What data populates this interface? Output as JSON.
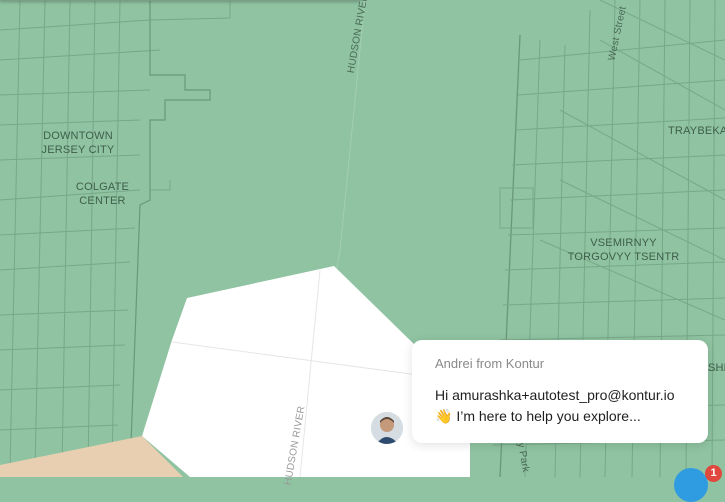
{
  "map": {
    "labels": {
      "downtown_line1": "DOWNTOWN",
      "downtown_line2": "JERSEY CITY",
      "colgate": "COLGATE CENTER",
      "tribeca": "TRAYBEKA",
      "wtc_line1": "VSEMIRNYY",
      "wtc_line2": "TORGOVYY TSENTR",
      "shl": "SHL"
    },
    "streets": {
      "hudson_river_top": "HUDSON RIVER",
      "hudson_river_bottom": "HUDSON RIVER",
      "west_street": "West Street",
      "parkway": "y Park"
    }
  },
  "chat": {
    "from": "Andrei from Kontur",
    "message_line1": "Hi amurashka+autotest_pro@kontur.io",
    "message_line2": "👋 I’m here to help you explore..."
  },
  "launcher": {
    "badge_count": "1"
  },
  "colors": {
    "map_green": "#8fc3a1",
    "polygon_white": "#ffffff",
    "polygon_beige": "#e8cfb1",
    "launcher_blue": "#2f9be0",
    "badge_red": "#e0473d"
  }
}
